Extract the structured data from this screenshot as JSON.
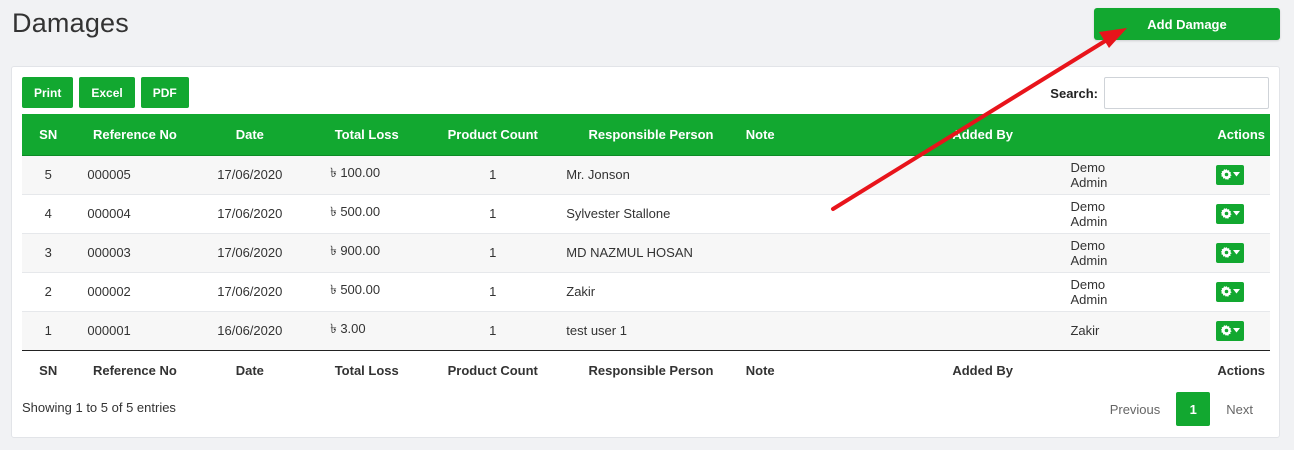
{
  "page": {
    "title": "Damages",
    "add_button_label": "Add Damage"
  },
  "toolbar": {
    "export_buttons": [
      "Print",
      "Excel",
      "PDF"
    ],
    "search_label": "Search:",
    "search_value": ""
  },
  "table": {
    "columns": [
      "SN",
      "Reference No",
      "Date",
      "Total Loss",
      "Product Count",
      "Responsible Person",
      "Note",
      "Added By",
      "Actions"
    ],
    "rows": [
      {
        "sn": "5",
        "ref": "000005",
        "date": "17/06/2020",
        "loss": "৳ 100.00",
        "count": "1",
        "person": "Mr. Jonson",
        "note": "",
        "added_by": "Demo Admin"
      },
      {
        "sn": "4",
        "ref": "000004",
        "date": "17/06/2020",
        "loss": "৳ 500.00",
        "count": "1",
        "person": "Sylvester Stallone",
        "note": "",
        "added_by": "Demo Admin"
      },
      {
        "sn": "3",
        "ref": "000003",
        "date": "17/06/2020",
        "loss": "৳ 900.00",
        "count": "1",
        "person": "MD NAZMUL HOSAN",
        "note": "",
        "added_by": "Demo Admin"
      },
      {
        "sn": "2",
        "ref": "000002",
        "date": "17/06/2020",
        "loss": "৳ 500.00",
        "count": "1",
        "person": "Zakir",
        "note": "",
        "added_by": "Demo Admin"
      },
      {
        "sn": "1",
        "ref": "000001",
        "date": "16/06/2020",
        "loss": "৳ 3.00",
        "count": "1",
        "person": "test user 1",
        "note": "",
        "added_by": "Zakir"
      }
    ]
  },
  "footer": {
    "info": "Showing 1 to 5 of 5 entries",
    "previous": "Previous",
    "current_page": "1",
    "next": "Next"
  },
  "colors": {
    "accent": "#12a830",
    "annotation_arrow": "#e8141b"
  },
  "icons": {
    "action": "gear-dropdown-icon"
  }
}
